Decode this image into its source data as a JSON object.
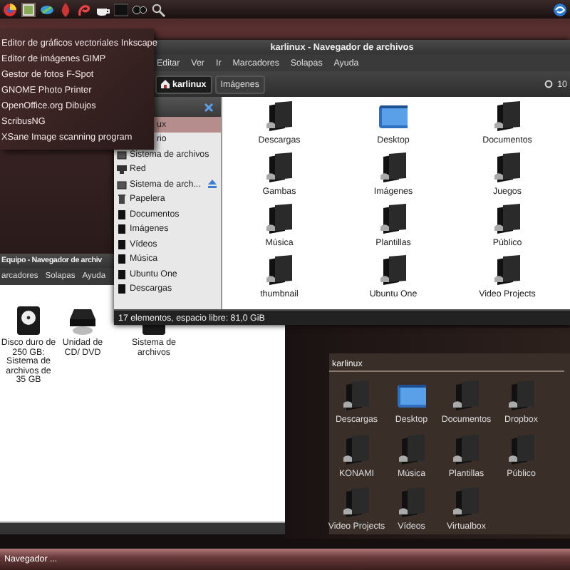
{
  "app_menu": {
    "items": [
      {
        "label": "Editor de gráficos vectoriales Inkscape"
      },
      {
        "label": "Editor de imágenes GIMP"
      },
      {
        "label": "Gestor de fotos F-Spot"
      },
      {
        "label": "GNOME Photo Printer"
      },
      {
        "label": "OpenOffice.org Dibujos"
      },
      {
        "label": "ScribusNG"
      },
      {
        "label": "XSane Image scanning program"
      }
    ]
  },
  "main_window": {
    "title": "karlinux - Navegador de archivos",
    "menu": [
      "Editar",
      "Ver",
      "Ir",
      "Marcadores",
      "Solapas",
      "Ayuda"
    ],
    "breadcrumbs": [
      {
        "label": "karlinux",
        "selected": true
      },
      {
        "label": "Imágenes",
        "selected": false
      }
    ],
    "zoom": "10",
    "sidebar": {
      "items": [
        {
          "label": "ux",
          "kind": "covered",
          "selected": true
        },
        {
          "label": "rio",
          "kind": "covered",
          "selected": false
        },
        {
          "label": "Sistema de archivos",
          "kind": "drive",
          "selected": false
        },
        {
          "label": "Red",
          "kind": "network",
          "selected": false
        },
        {
          "label": "Sistema de arch...",
          "kind": "removable",
          "selected": false
        },
        {
          "label": "Papelera",
          "kind": "trash",
          "selected": false
        },
        {
          "label": "Documentos",
          "kind": "folder",
          "selected": false
        },
        {
          "label": "Imágenes",
          "kind": "folder",
          "selected": false
        },
        {
          "label": "Vídeos",
          "kind": "folder",
          "selected": false
        },
        {
          "label": "Música",
          "kind": "folder",
          "selected": false
        },
        {
          "label": "Ubuntu One",
          "kind": "folder",
          "selected": false
        },
        {
          "label": "Descargas",
          "kind": "folder",
          "selected": false
        }
      ]
    },
    "files": [
      {
        "name": "Descargas",
        "kind": "folder"
      },
      {
        "name": "Desktop",
        "kind": "desktop"
      },
      {
        "name": "Documentos",
        "kind": "folder"
      },
      {
        "name": "Gambas",
        "kind": "folder"
      },
      {
        "name": "Imágenes",
        "kind": "folder"
      },
      {
        "name": "Juegos",
        "kind": "folder"
      },
      {
        "name": "Música",
        "kind": "folder"
      },
      {
        "name": "Plantillas",
        "kind": "folder"
      },
      {
        "name": "Público",
        "kind": "folder"
      },
      {
        "name": "thumbnail",
        "kind": "folder"
      },
      {
        "name": "Ubuntu One",
        "kind": "folder"
      },
      {
        "name": "Video Projects",
        "kind": "folder"
      }
    ],
    "status": "17 elementos, espacio libre: 81,0 GiB"
  },
  "computer_window": {
    "title": "Equipo - Navegador de archiv",
    "menu": [
      "arcadores",
      "Solapas",
      "Ayuda"
    ],
    "items": [
      {
        "name": "Disco duro de 250 GB: Sistema de archivos de 35 GB",
        "kind": "disk"
      },
      {
        "name": "Unidad de CD/ DVD",
        "kind": "optical"
      },
      {
        "name": "Sistema de archivos",
        "kind": "disk"
      }
    ]
  },
  "dark_window": {
    "path": "karlinux",
    "files": [
      {
        "name": "Descargas",
        "kind": "folder"
      },
      {
        "name": "Desktop",
        "kind": "desktop"
      },
      {
        "name": "Documentos",
        "kind": "folder"
      },
      {
        "name": "Dropbox",
        "kind": "folder"
      },
      {
        "name": "KONAMI",
        "kind": "folder"
      },
      {
        "name": "Música",
        "kind": "folder"
      },
      {
        "name": "Plantillas",
        "kind": "folder"
      },
      {
        "name": "Público",
        "kind": "folder"
      },
      {
        "name": "Video Projects",
        "kind": "folder"
      },
      {
        "name": "Vídeos",
        "kind": "folder"
      },
      {
        "name": "Virtualbox",
        "kind": "folder"
      }
    ]
  },
  "taskbar": {
    "items": [
      {
        "label": "Navegador ..."
      }
    ]
  }
}
